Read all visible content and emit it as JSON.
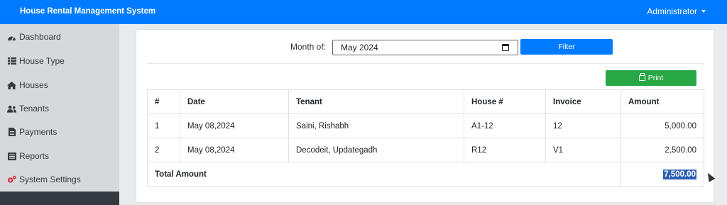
{
  "header": {
    "title": "House Rental Management System",
    "user": "Administrator"
  },
  "sidebar": {
    "items": [
      {
        "label": "Dashboard",
        "icon": "tachometer-icon"
      },
      {
        "label": "House Type",
        "icon": "list-icon"
      },
      {
        "label": "Houses",
        "icon": "home-icon"
      },
      {
        "label": "Tenants",
        "icon": "users-icon"
      },
      {
        "label": "Payments",
        "icon": "file-invoice-icon"
      },
      {
        "label": "Reports",
        "icon": "list-alt-icon"
      },
      {
        "label": "System Settings",
        "icon": "cogs-icon"
      }
    ]
  },
  "filter": {
    "label": "Month of:",
    "value": "May 2024",
    "button": "Filter"
  },
  "print": {
    "label": "Print"
  },
  "table": {
    "headers": [
      "#",
      "Date",
      "Tenant",
      "House #",
      "Invoice",
      "Amount"
    ],
    "rows": [
      [
        "1",
        "May 08,2024",
        "Saini, Rishabh",
        "A1-12",
        "12",
        "5,000.00"
      ],
      [
        "2",
        "May 08,2024",
        "Decodeit, Updategadh",
        "R12",
        "V1",
        "2,500.00"
      ]
    ],
    "total_label": "Total Amount",
    "total_value": "7,500.00"
  },
  "colors": {
    "primary": "#007bff",
    "success": "#28a745",
    "sidebar": "#d6d8db",
    "selection": "#2f5fb3"
  }
}
